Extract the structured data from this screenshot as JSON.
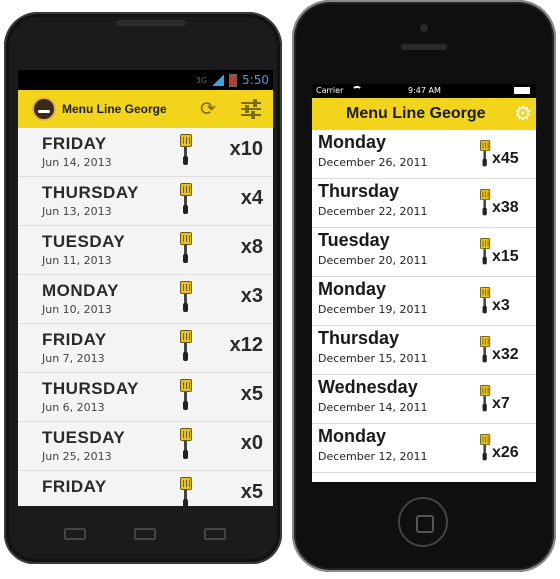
{
  "android": {
    "status": {
      "network": "3G",
      "time": "5:50"
    },
    "app_title": "Menu Line George",
    "rows": [
      {
        "day": "FRIDAY",
        "date": "Jun 14, 2013",
        "count": "x10"
      },
      {
        "day": "THURSDAY",
        "date": "Jun 13, 2013",
        "count": "x4"
      },
      {
        "day": "TUESDAY",
        "date": "Jun 11, 2013",
        "count": "x8"
      },
      {
        "day": "MONDAY",
        "date": "Jun 10, 2013",
        "count": "x3"
      },
      {
        "day": "FRIDAY",
        "date": "Jun 7, 2013",
        "count": "x12"
      },
      {
        "day": "THURSDAY",
        "date": "Jun 6, 2013",
        "count": "x5"
      },
      {
        "day": "TUESDAY",
        "date": "Jun 25, 2013",
        "count": "x0"
      },
      {
        "day": "FRIDAY",
        "date": "",
        "count": "x5"
      }
    ]
  },
  "iphone": {
    "status": {
      "carrier": "Carrier",
      "time": "9:47 AM"
    },
    "app_title": "Menu Line George",
    "rows": [
      {
        "day": "Monday",
        "date": "December 26, 2011",
        "count": "x45"
      },
      {
        "day": "Thursday",
        "date": "December 22, 2011",
        "count": "x38"
      },
      {
        "day": "Tuesday",
        "date": "December 20, 2011",
        "count": "x15"
      },
      {
        "day": "Monday",
        "date": "December 19, 2011",
        "count": "x3"
      },
      {
        "day": "Thursday",
        "date": "December 15, 2011",
        "count": "x32"
      },
      {
        "day": "Wednesday",
        "date": "December 14, 2011",
        "count": "x7"
      },
      {
        "day": "Monday",
        "date": "December 12, 2011",
        "count": "x26"
      }
    ]
  },
  "icons": {
    "refresh": "refresh-icon",
    "settings": "sliders-icon",
    "gear": "gear-icon",
    "spatula": "spatula-icon"
  }
}
